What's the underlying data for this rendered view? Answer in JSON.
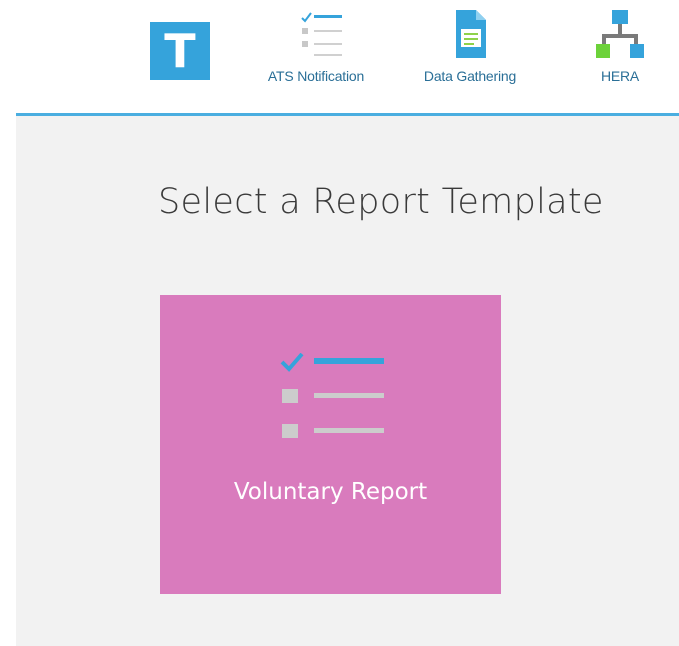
{
  "brand": {
    "letter": "T"
  },
  "nav": [
    {
      "label": "ATS Notification",
      "icon": "checklist-icon"
    },
    {
      "label": "Data Gathering",
      "icon": "document-icon"
    },
    {
      "label": "HERA",
      "icon": "hierarchy-icon"
    }
  ],
  "main": {
    "title": "Select a Report Template",
    "templates": [
      {
        "label": "Voluntary Report",
        "icon": "checklist-icon"
      }
    ]
  },
  "colors": {
    "accent": "#35a3db",
    "tile": "#d97bbd",
    "content_bg": "#f2f2f2",
    "nav_text": "#2a6f97"
  }
}
